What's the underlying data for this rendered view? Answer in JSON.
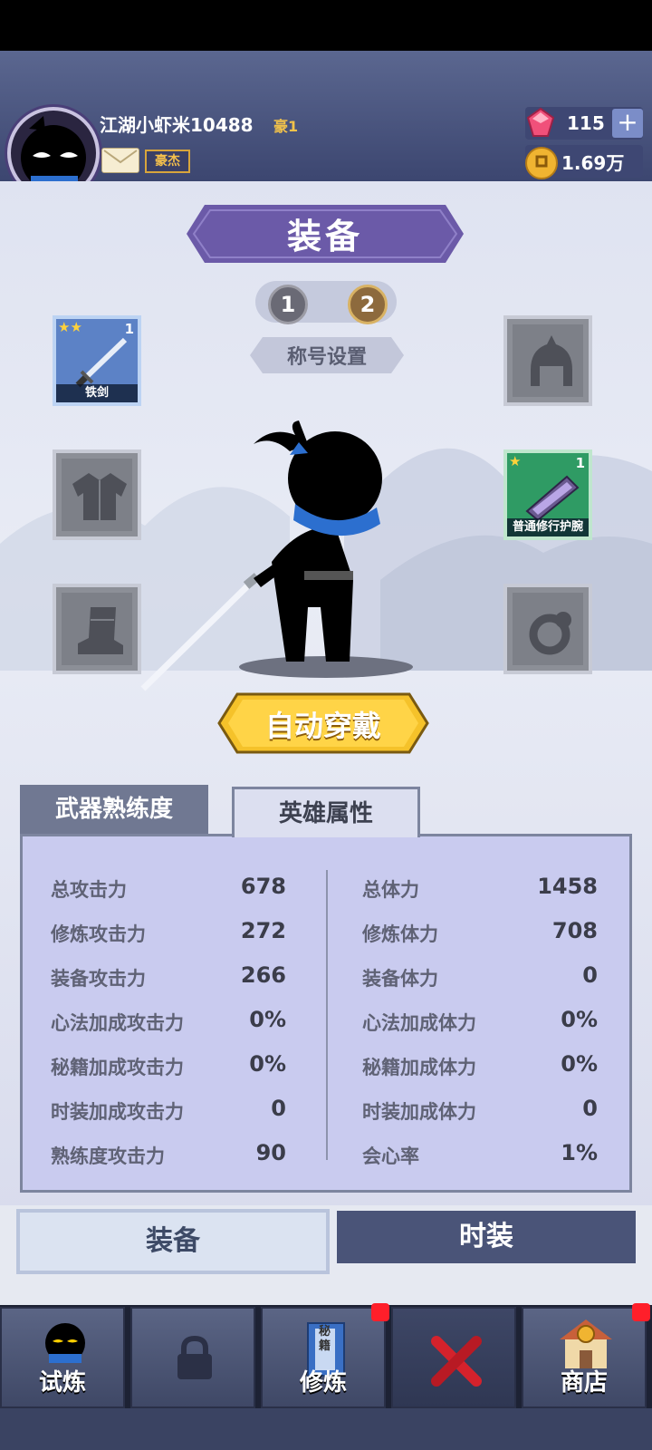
{
  "player": {
    "name": "江湖小虾米10488",
    "vip": "豪1",
    "rank": "豪杰"
  },
  "currency": {
    "gems": "115",
    "coins": "1.69万"
  },
  "screen_title": "装备",
  "presets": [
    "1",
    "2"
  ],
  "title_setting_label": "称号设置",
  "slots": {
    "weapon": {
      "name": "铁剑",
      "level": "1",
      "stars": "★★"
    },
    "bracer": {
      "name": "普通修行护腕",
      "level": "1",
      "stars": "★"
    }
  },
  "auto_equip_label": "自动穿戴",
  "stat_tabs": [
    "武器熟练度",
    "英雄属性"
  ],
  "stats_left": [
    {
      "label": "总攻击力",
      "value": "678"
    },
    {
      "label": "修炼攻击力",
      "value": "272"
    },
    {
      "label": "装备攻击力",
      "value": "266"
    },
    {
      "label": "心法加成攻击力",
      "value": "0%"
    },
    {
      "label": "秘籍加成攻击力",
      "value": "0%"
    },
    {
      "label": "时装加成攻击力",
      "value": "0"
    },
    {
      "label": "熟练度攻击力",
      "value": "90"
    }
  ],
  "stats_right": [
    {
      "label": "总体力",
      "value": "1458"
    },
    {
      "label": "修炼体力",
      "value": "708"
    },
    {
      "label": "装备体力",
      "value": "0"
    },
    {
      "label": "心法加成体力",
      "value": "0%"
    },
    {
      "label": "秘籍加成体力",
      "value": "0%"
    },
    {
      "label": "时装加成体力",
      "value": "0"
    },
    {
      "label": "会心率",
      "value": "1%"
    }
  ],
  "bottom_tabs": [
    "装备",
    "时装"
  ],
  "nav": [
    {
      "label": "试炼"
    },
    {
      "label": ""
    },
    {
      "label": "修炼",
      "book_text": "秘籍"
    },
    {
      "label": ""
    },
    {
      "label": "商店"
    }
  ],
  "colors": {
    "header_bg": "#4a5580",
    "accent_gold": "#f2c24a",
    "title_banner": "#6b5aa8",
    "notification_red": "#ff1f2a"
  }
}
